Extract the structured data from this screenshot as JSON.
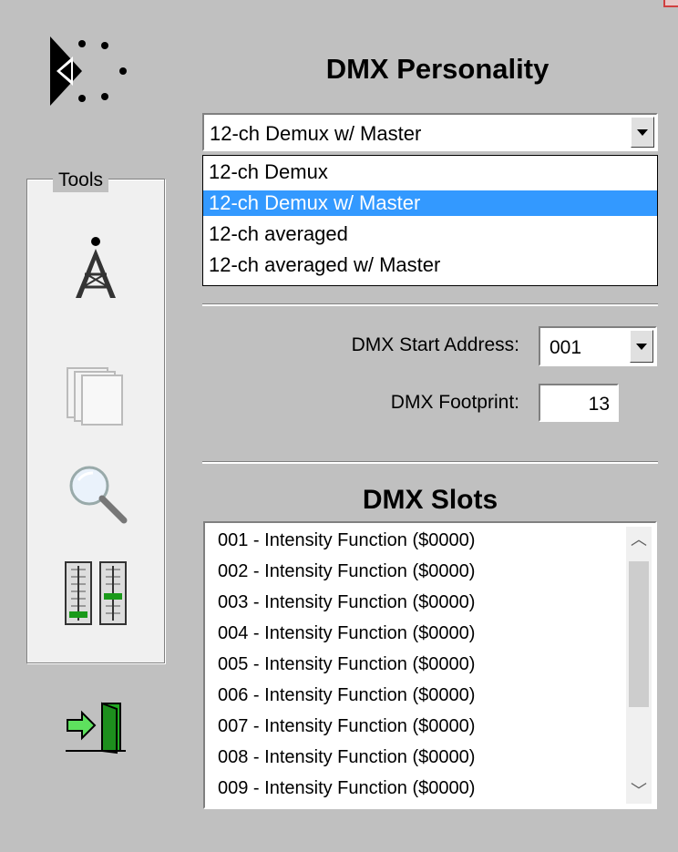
{
  "personality": {
    "heading": "DMX Personality",
    "selected": "12-ch Demux w/ Master",
    "options": [
      "12-ch Demux",
      "12-ch Demux w/ Master",
      "12-ch averaged",
      "12-ch averaged w/ Master"
    ],
    "selected_index": 1
  },
  "tools": {
    "label": "Tools",
    "icons": [
      "tower-icon",
      "pages-icon",
      "magnifier-icon",
      "faders-icon"
    ]
  },
  "start_address": {
    "label": "DMX Start Address:",
    "value": "001"
  },
  "footprint": {
    "label": "DMX Footprint:",
    "value": "13"
  },
  "slots": {
    "heading": "DMX Slots",
    "items": [
      "001 - Intensity Function ($0000)",
      "002 - Intensity Function ($0000)",
      "003 - Intensity Function ($0000)",
      "004 - Intensity Function ($0000)",
      "005 - Intensity Function ($0000)",
      "006 - Intensity Function ($0000)",
      "007 - Intensity Function ($0000)",
      "008 - Intensity Function ($0000)",
      "009 - Intensity Function ($0000)"
    ]
  },
  "colors": {
    "selection": "#3399ff",
    "exit_door": "#22aa22",
    "background": "#c0c0c0"
  }
}
